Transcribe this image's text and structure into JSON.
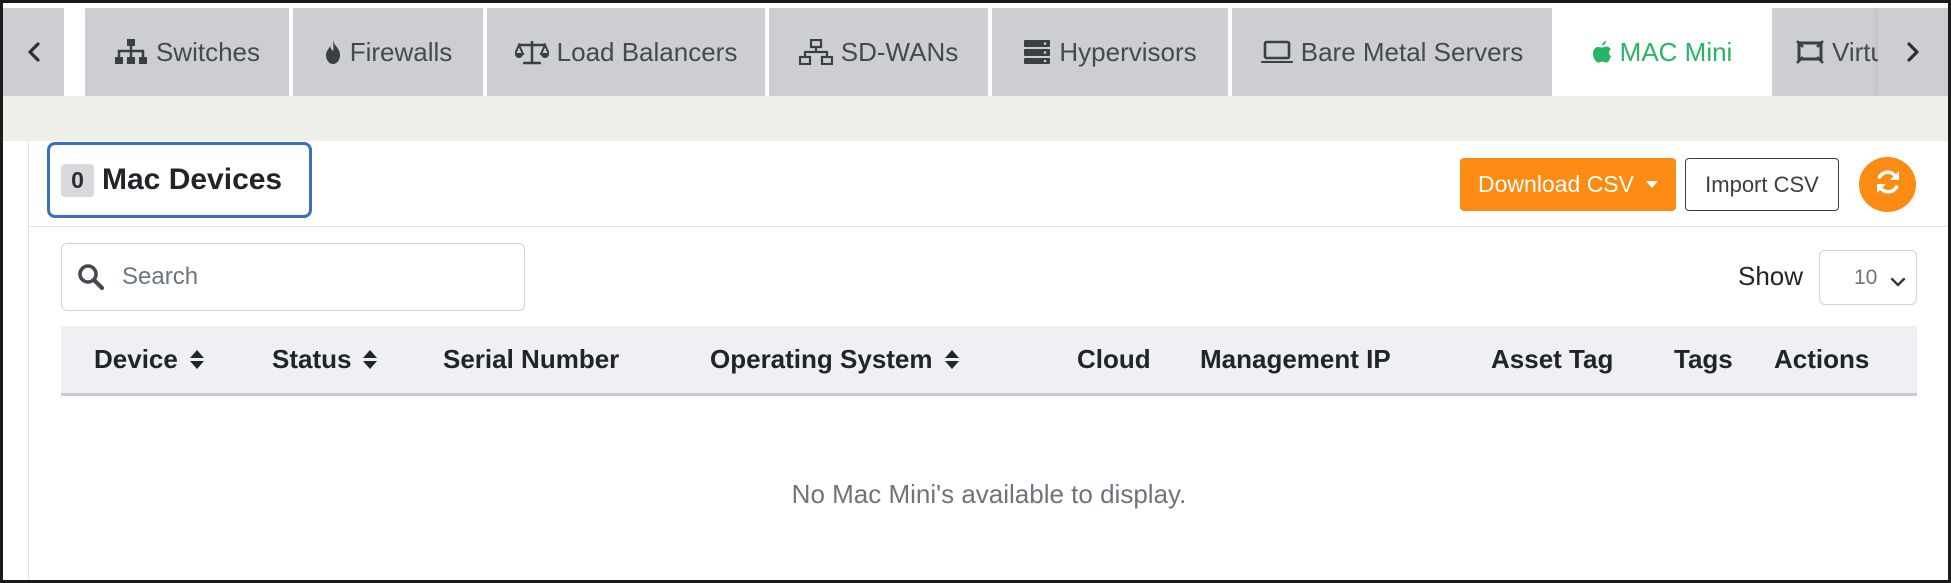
{
  "tabs": [
    {
      "label": "Switches",
      "icon": "sitemap-icon",
      "active": false
    },
    {
      "label": "Firewalls",
      "icon": "fire-icon",
      "active": false
    },
    {
      "label": "Load Balancers",
      "icon": "balance-scale-icon",
      "active": false
    },
    {
      "label": "SD-WANs",
      "icon": "network-icon",
      "active": false
    },
    {
      "label": "Hypervisors",
      "icon": "server-icon",
      "active": false
    },
    {
      "label": "Bare Metal Servers",
      "icon": "laptop-icon",
      "active": false
    },
    {
      "label": "MAC Mini",
      "icon": "apple-icon",
      "active": true
    },
    {
      "label": "Virtu",
      "icon": "vm-icon",
      "active": false
    }
  ],
  "nav": {
    "prev_icon": "chevron-left-icon",
    "next_icon": "chevron-right-icon"
  },
  "card": {
    "count": "0",
    "title": "Mac Devices",
    "download_label": "Download CSV",
    "import_label": "Import CSV",
    "refresh_icon": "refresh-icon"
  },
  "search": {
    "placeholder": "Search",
    "value": ""
  },
  "show": {
    "label": "Show",
    "value": "10"
  },
  "table": {
    "columns": [
      {
        "label": "Device",
        "sortable": true
      },
      {
        "label": "Status",
        "sortable": true
      },
      {
        "label": "Serial Number",
        "sortable": false
      },
      {
        "label": "Operating System",
        "sortable": true
      },
      {
        "label": "Cloud",
        "sortable": false
      },
      {
        "label": "Management IP",
        "sortable": false
      },
      {
        "label": "Asset Tag",
        "sortable": false
      },
      {
        "label": "Tags",
        "sortable": false
      },
      {
        "label": "Actions",
        "sortable": false
      }
    ],
    "rows": [],
    "empty_message": "No Mac Mini's available to display."
  },
  "colors": {
    "accent_orange": "#fb8b12",
    "active_tab_green": "#28b463",
    "highlight_blue": "#3c6dc4",
    "tab_grey": "#ccced2"
  }
}
